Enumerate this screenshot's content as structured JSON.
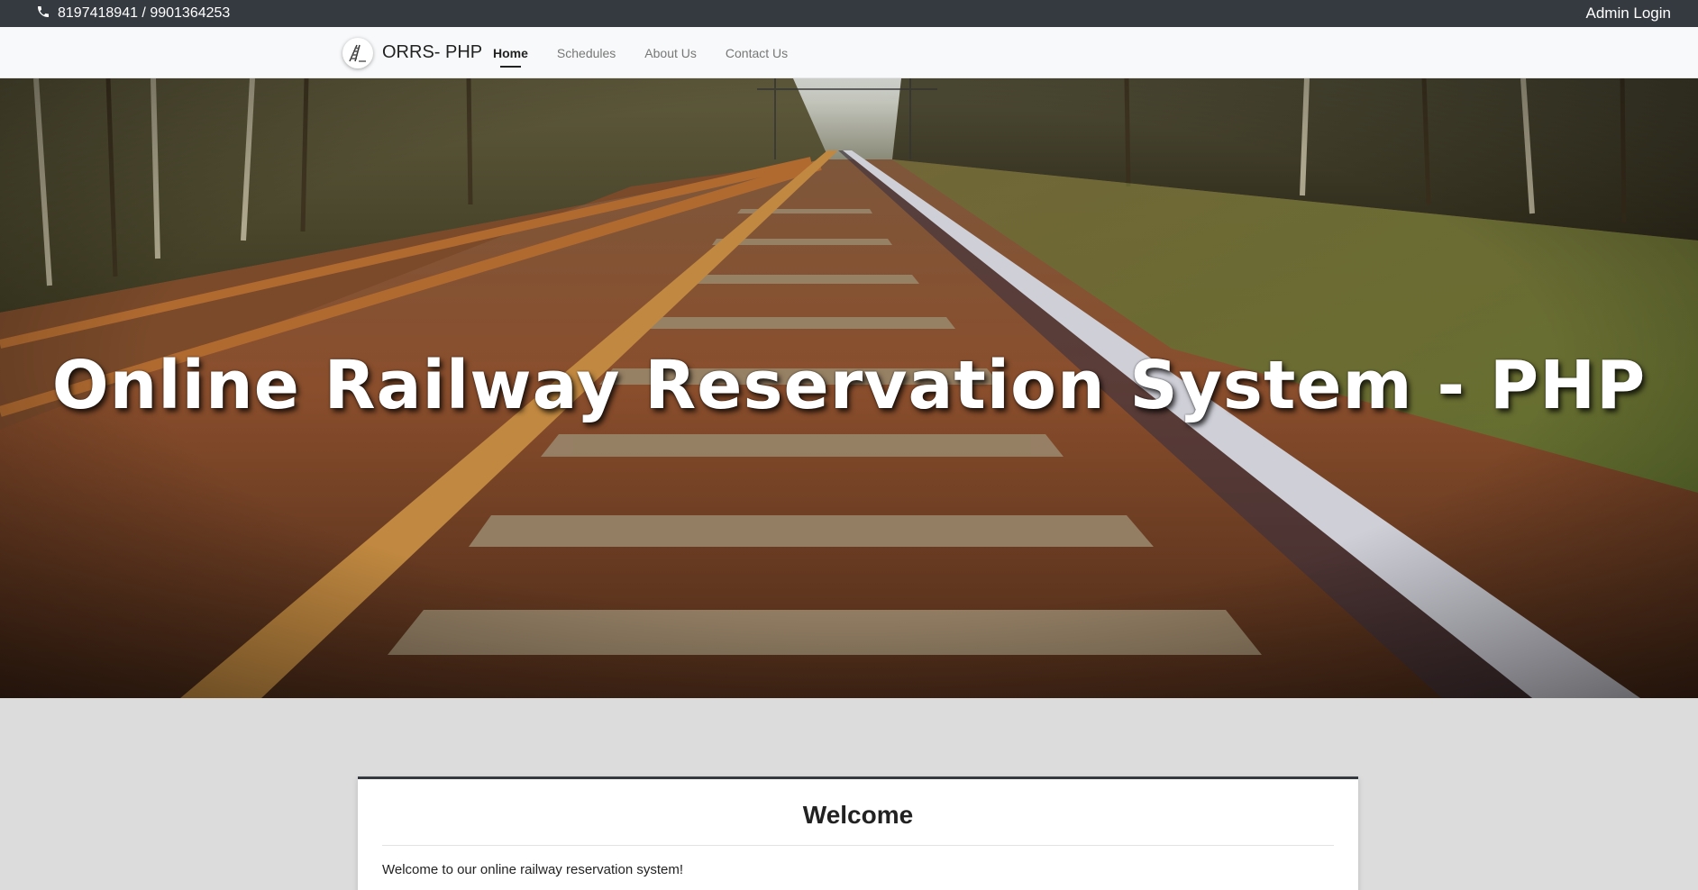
{
  "topbar": {
    "phone": "8197418941 / 9901364253",
    "admin_login": "Admin Login"
  },
  "navbar": {
    "brand": "ORRS- PHP",
    "items": [
      {
        "label": "Home",
        "active": true
      },
      {
        "label": "Schedules",
        "active": false
      },
      {
        "label": "About Us",
        "active": false
      },
      {
        "label": "Contact Us",
        "active": false
      }
    ]
  },
  "hero": {
    "title": "Online Railway Reservation System - PHP"
  },
  "welcome": {
    "title": "Welcome",
    "text": "Welcome to our online railway reservation system!"
  },
  "icons": {
    "phone": "phone-icon",
    "logo": "railway-logo-icon"
  }
}
